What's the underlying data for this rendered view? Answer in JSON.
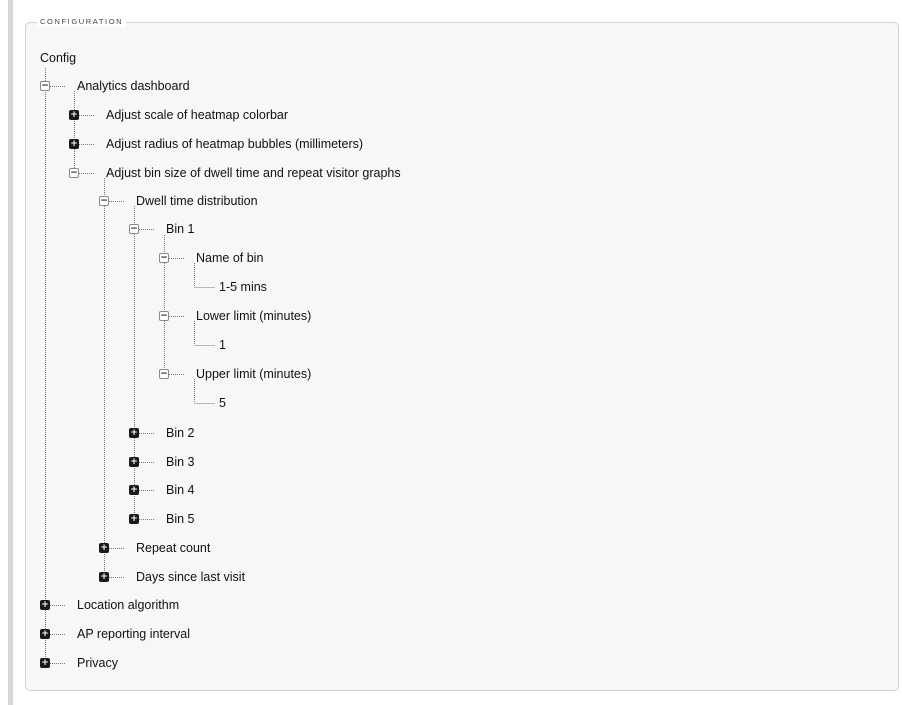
{
  "fieldset": {
    "legend": "CONFIGURATION"
  },
  "tree": {
    "root_label": "Config",
    "nodes": {
      "analytics": {
        "label": "Analytics dashboard",
        "state": "expanded"
      },
      "heatmap_scale": {
        "label": "Adjust scale of heatmap colorbar",
        "state": "collapsed"
      },
      "heatmap_radius": {
        "label": "Adjust radius of heatmap bubbles (millimeters)",
        "state": "collapsed"
      },
      "bin_size": {
        "label": "Adjust bin size of dwell time and repeat visitor graphs",
        "state": "expanded"
      },
      "dwell": {
        "label": "Dwell time distribution",
        "state": "expanded"
      },
      "bin1": {
        "label": "Bin 1",
        "state": "expanded"
      },
      "bin1_name": {
        "label": "Name of bin",
        "state": "expanded"
      },
      "bin1_name_value": {
        "label": "1-5 mins"
      },
      "bin1_lower": {
        "label": "Lower limit (minutes)",
        "state": "expanded"
      },
      "bin1_lower_value": {
        "label": "1"
      },
      "bin1_upper": {
        "label": "Upper limit (minutes)",
        "state": "expanded"
      },
      "bin1_upper_value": {
        "label": "5"
      },
      "bin2": {
        "label": "Bin 2",
        "state": "collapsed"
      },
      "bin3": {
        "label": "Bin 3",
        "state": "collapsed"
      },
      "bin4": {
        "label": "Bin 4",
        "state": "collapsed"
      },
      "bin5": {
        "label": "Bin 5",
        "state": "collapsed"
      },
      "repeat": {
        "label": "Repeat count",
        "state": "collapsed"
      },
      "days": {
        "label": "Days since last visit",
        "state": "collapsed"
      },
      "location": {
        "label": "Location algorithm",
        "state": "collapsed"
      },
      "ap": {
        "label": "AP reporting interval",
        "state": "collapsed"
      },
      "privacy": {
        "label": "Privacy",
        "state": "collapsed"
      }
    }
  }
}
